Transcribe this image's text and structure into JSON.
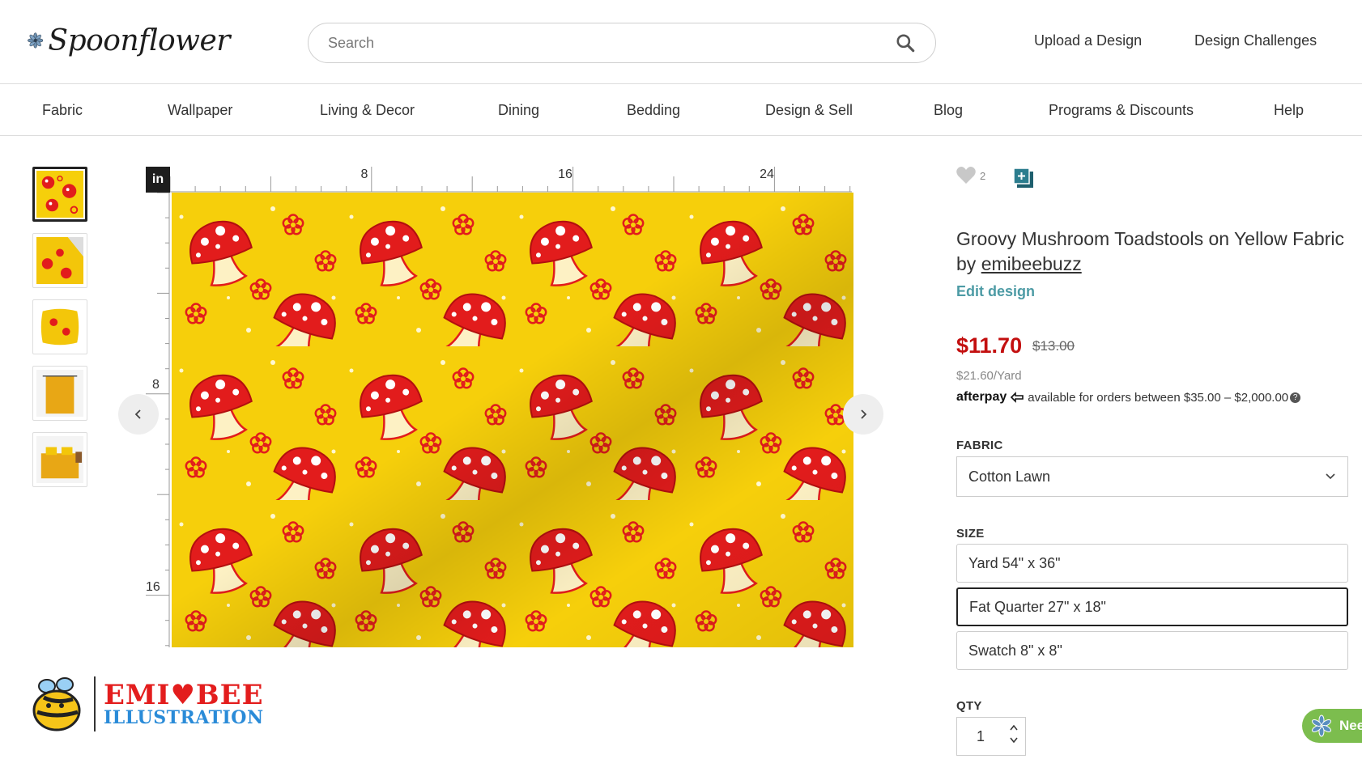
{
  "header": {
    "logo_text": "Spoonflower",
    "search_placeholder": "Search",
    "upload_label": "Upload a Design",
    "challenges_label": "Design Challenges"
  },
  "nav": {
    "items": [
      "Fabric",
      "Wallpaper",
      "Living & Decor",
      "Dining",
      "Bedding",
      "Design & Sell",
      "Blog",
      "Programs & Discounts",
      "Help"
    ]
  },
  "viewer": {
    "unit": "in",
    "top_ticks": [
      "8",
      "16",
      "24"
    ],
    "left_ticks": [
      "8",
      "16"
    ]
  },
  "brand": {
    "line1": "EMI♥BEE",
    "line2": "ILLUSTRATION"
  },
  "product": {
    "favorites": "2",
    "title": "Groovy Mushroom Toadstools on Yellow Fabric",
    "by": "by",
    "designer": "emibeebuzz",
    "edit_label": "Edit design",
    "price": "$11.70",
    "old_price": "$13.00",
    "per_yard": "$21.60/Yard",
    "afterpay_brand": "afterpay",
    "afterpay_text": "available for orders between $35.00 – $2,000.00",
    "fabric_label": "FABRIC",
    "fabric_value": "Cotton Lawn",
    "size_label": "SIZE",
    "sizes": [
      "Yard 54\" x 36\"",
      "Fat Quarter 27\" x 18\"",
      "Swatch 8\" x 8\""
    ],
    "qty_label": "QTY",
    "qty_value": "1"
  },
  "help": {
    "label": "Nee"
  },
  "colors": {
    "accent_teal": "#4d9ba5",
    "price_red": "#c30f0f",
    "fabric_yellow": "#f6cf0b",
    "mushroom_red": "#e21c1c",
    "help_green": "#7cbd4e"
  }
}
